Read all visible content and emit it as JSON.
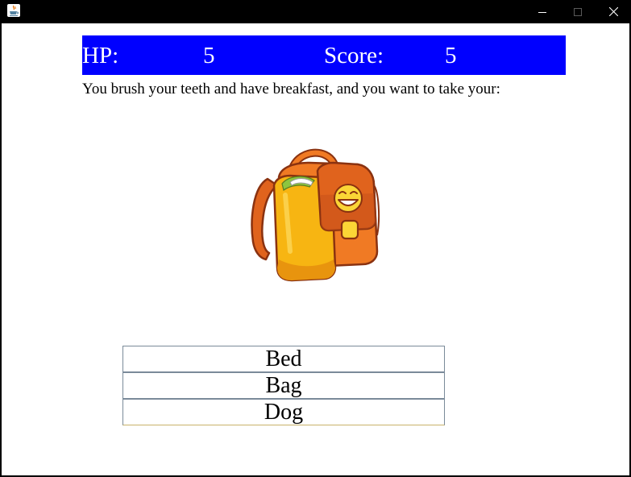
{
  "window": {
    "app_icon": "java-cup-icon",
    "controls": [
      "minimize-icon",
      "maximize-icon",
      "close-icon"
    ]
  },
  "status": {
    "hp_label": "HP:",
    "hp_value": "5",
    "score_label": "Score:",
    "score_value": "5",
    "bar_color": "#0000ff"
  },
  "story": {
    "text": "You brush your teeth and have breakfast, and you want to take your:"
  },
  "scene": {
    "image": "backpack-icon"
  },
  "choices": [
    {
      "label": "Bed"
    },
    {
      "label": "Bag"
    },
    {
      "label": "Dog"
    }
  ]
}
